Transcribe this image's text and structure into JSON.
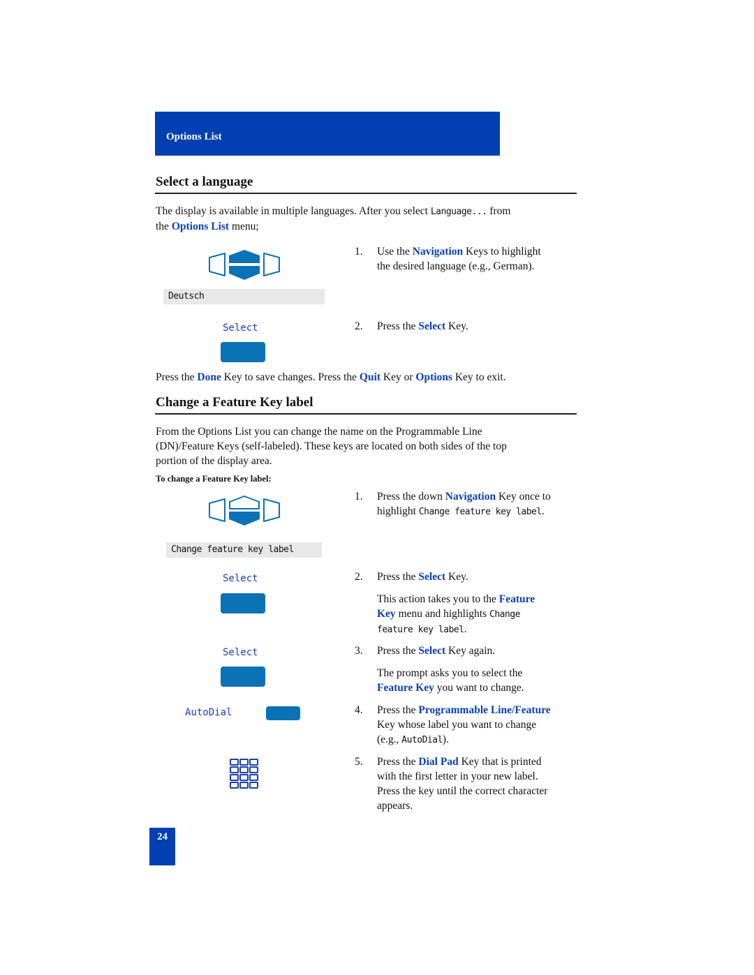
{
  "banner": {
    "title": "Options List"
  },
  "section1": {
    "heading": "Select a language",
    "intro": {
      "part1": "The display is available in multiple languages. After you select ",
      "lcd_term": "Language...",
      "part2": " from",
      "part3": "the ",
      "link": "Options List",
      "part4": " menu;"
    },
    "lcd_display": "Deutsch",
    "softkey_label": "Select",
    "steps": [
      {
        "num": "1.",
        "pre": "Use the ",
        "key": "Navigation",
        "post": " Keys to highlight",
        "line2": "the desired language (e.g., German)."
      },
      {
        "num": "2.",
        "pre": "Press the ",
        "key": "Select",
        "post": " Key."
      }
    ],
    "footer": {
      "p1": "Press the ",
      "k1": "Done",
      "p2": " Key to save changes. Press the ",
      "k2": "Quit",
      "p3": " Key or ",
      "k3": "Options",
      "p4": " Key to exit."
    }
  },
  "section2": {
    "heading": "Change a Feature Key label",
    "intro_lines": [
      "From the Options List you can change the name on the Programmable Line",
      "(DN)/Feature Keys (self-labeled). These keys are located on both sides of the top",
      "portion of the display area."
    ],
    "subhead": "To change a Feature Key label:",
    "lcd_display": "Change feature key label",
    "softkey_label_1": "Select",
    "softkey_label_2": "Select",
    "line_key_label": "AutoDial",
    "steps": {
      "s1": {
        "num": "1.",
        "pre": "Press the down ",
        "key": "Navigation",
        "post": " Key once to",
        "line2_pre": "highlight ",
        "line2_lcd": "Change feature key label",
        "line2_post": "."
      },
      "s2": {
        "num": "2.",
        "pre": "Press the ",
        "key": "Select",
        "post": " Key."
      },
      "s2_note": {
        "pre": "This action takes you to the ",
        "key1": "Feature",
        "key2": "Key",
        "mid": " menu and highlights ",
        "lcd1": "Change",
        "lcd2": "feature key label",
        "post": "."
      },
      "s3": {
        "num": "3.",
        "pre": "Press the ",
        "key": "Select",
        "post": " Key again."
      },
      "s3_note": {
        "line1": "The prompt asks you to select the",
        "key": "Feature Key",
        "post": " you want to change."
      },
      "s4": {
        "num": "4.",
        "pre": "Press the ",
        "key": "Programmable Line/Feature",
        "line2": "Key whose label you want to change",
        "line3_pre": "(e.g., ",
        "line3_lcd": "AutoDial",
        "line3_post": ")."
      },
      "s5": {
        "num": "5.",
        "pre": "Press the ",
        "key": "Dial Pad",
        "post": " Key that is printed",
        "line2": "with the first letter in your new label.",
        "line3": "Press the key until the correct character",
        "line4": "appears."
      }
    }
  },
  "page_number": "24",
  "colors": {
    "brand_blue": "#0040b0",
    "link_blue": "#0b3fb3",
    "key_blue": "#0a72b5",
    "lcd_bg": "#e8e8e8"
  }
}
